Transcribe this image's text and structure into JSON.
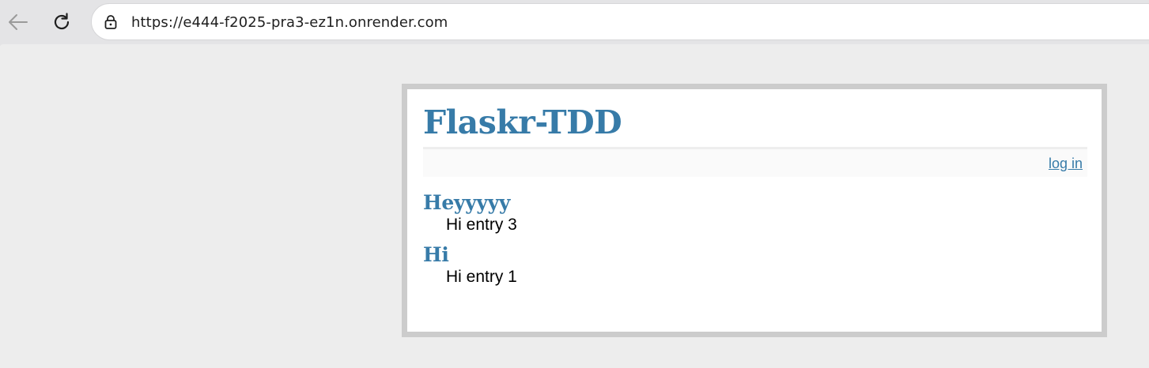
{
  "browser": {
    "url": "https://e444-f2025-pra3-ez1n.onrender.com",
    "icons": {
      "back": "arrow-left-icon",
      "reload": "reload-icon",
      "security": "lock-icon"
    }
  },
  "page": {
    "title": "Flaskr-TDD",
    "login_label": "log in",
    "entries": [
      {
        "title": "Heyyyyy",
        "text": "Hi entry 3"
      },
      {
        "title": "Hi",
        "text": "Hi entry 1"
      }
    ],
    "colors": {
      "accent": "#377ba8",
      "border": "#cccccc",
      "background": "#ededed"
    }
  }
}
